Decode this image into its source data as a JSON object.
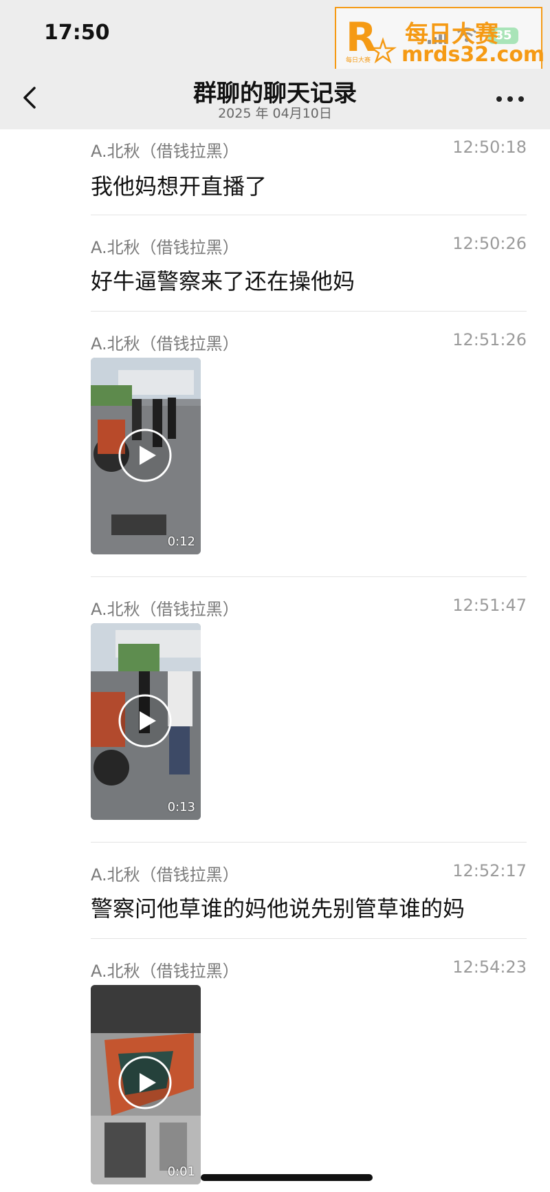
{
  "status": {
    "time": "17:50",
    "battery": "85"
  },
  "watermark": {
    "line1": "每日大赛",
    "line2": "mrds32.com",
    "logo_letter": "R",
    "logo_caption": "每日大赛"
  },
  "header": {
    "title": "群聊的聊天记录",
    "date": "2025 年 04月10日"
  },
  "messages": [
    {
      "sender": "A.北秋（借钱拉黑）",
      "time": "12:50:18",
      "text": "我他妈想开直播了"
    },
    {
      "sender": "A.北秋（借钱拉黑）",
      "time": "12:50:26",
      "text": "好牛逼警察来了还在操他妈"
    },
    {
      "sender": "A.北秋（借钱拉黑）",
      "time": "12:51:26",
      "video_duration": "0:12"
    },
    {
      "sender": "A.北秋（借钱拉黑）",
      "time": "12:51:47",
      "video_duration": "0:13"
    },
    {
      "sender": "A.北秋（借钱拉黑）",
      "time": "12:52:17",
      "text": "警察问他草谁的妈他说先别管草谁的妈"
    },
    {
      "sender": "A.北秋（借钱拉黑）",
      "time": "12:54:23",
      "video_duration": "0:01"
    }
  ],
  "colors": {
    "accent": "#f59a14",
    "battery": "#41c463",
    "header_bg": "#ededed"
  }
}
